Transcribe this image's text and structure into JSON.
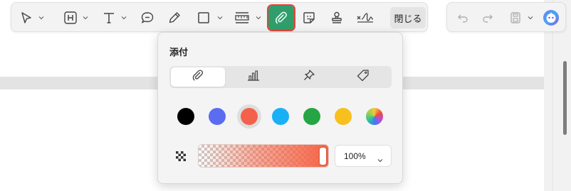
{
  "toolbar": {
    "tools": [
      {
        "name": "select-tool",
        "icon": "cursor-arrow-icon"
      },
      {
        "name": "heading-tool",
        "icon": "heading-h-icon"
      },
      {
        "name": "text-tool",
        "icon": "text-t-icon"
      },
      {
        "name": "comment-tool",
        "icon": "speech-bubble-icon"
      },
      {
        "name": "pen-tool",
        "icon": "pen-icon"
      },
      {
        "name": "shape-tool",
        "icon": "square-icon"
      },
      {
        "name": "measure-tool",
        "icon": "ruler-icon"
      },
      {
        "name": "attachment-tool",
        "icon": "paperclip-icon",
        "active": true
      },
      {
        "name": "sticker-tool",
        "icon": "sticker-icon"
      },
      {
        "name": "stamp-tool",
        "icon": "stamp-icon"
      },
      {
        "name": "signature-tool",
        "icon": "signature-icon"
      }
    ],
    "close_label": "閉じる",
    "active_color": "#2f9e6b",
    "active_outline": "#e0453a"
  },
  "toolbar_right": {
    "tools": [
      {
        "name": "undo-button",
        "icon": "undo-icon"
      },
      {
        "name": "redo-button",
        "icon": "redo-icon"
      },
      {
        "name": "save-button",
        "icon": "save-icon"
      },
      {
        "name": "assistant-button",
        "icon": "ai-assistant-icon"
      }
    ]
  },
  "popup": {
    "title": "添付",
    "tabs": [
      {
        "name": "tab-attachment",
        "icon": "paperclip-icon",
        "selected": true
      },
      {
        "name": "tab-graph",
        "icon": "bar-chart-icon"
      },
      {
        "name": "tab-pushpin",
        "icon": "pushpin-icon"
      },
      {
        "name": "tab-tag",
        "icon": "tag-icon"
      }
    ],
    "colors": [
      "#000000",
      "#5b6cf0",
      "#f4614a",
      "#1ab0f5",
      "#25a544",
      "#f7c01f",
      "rainbow"
    ],
    "selected_color": "#f4614a",
    "opacity_percent": 100,
    "opacity_label": "100%"
  }
}
